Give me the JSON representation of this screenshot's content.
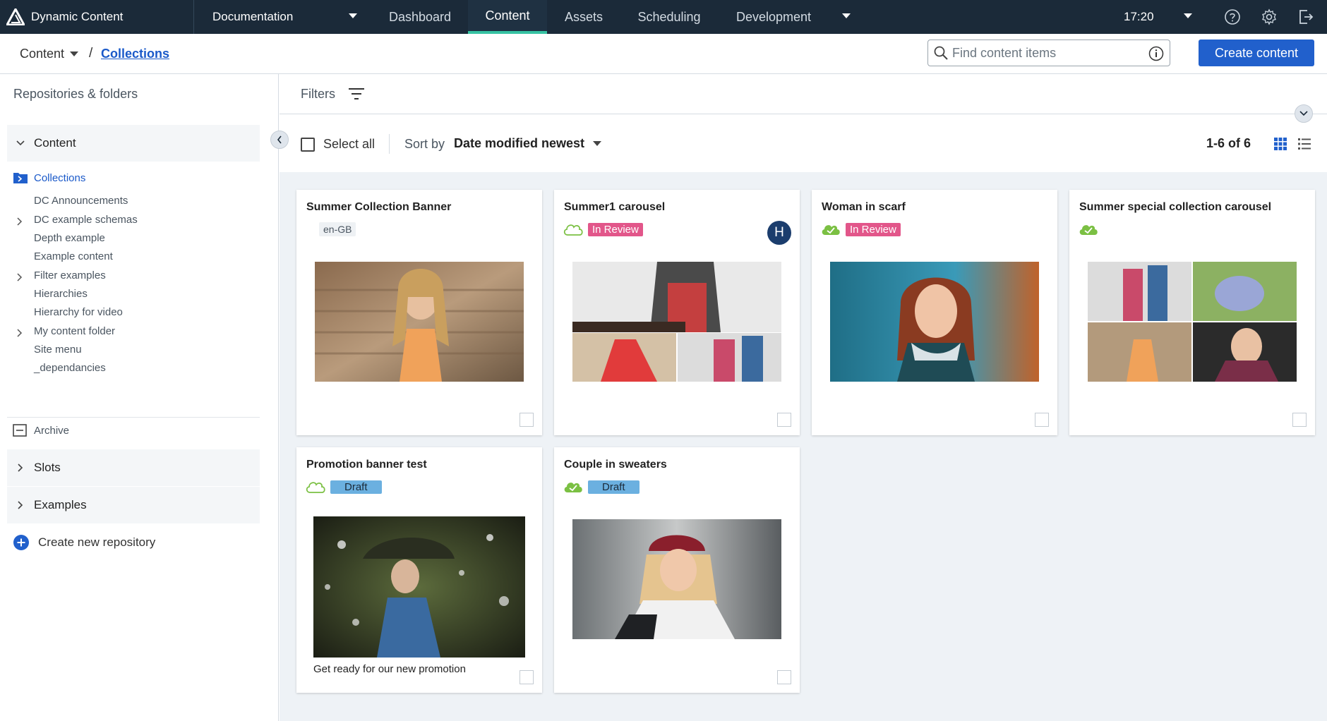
{
  "app": {
    "name": "Dynamic Content",
    "hub": "Documentation"
  },
  "nav": {
    "tabs": [
      {
        "label": "Dashboard"
      },
      {
        "label": "Content"
      },
      {
        "label": "Assets"
      },
      {
        "label": "Scheduling"
      },
      {
        "label": "Development"
      }
    ],
    "active_tab": "Content",
    "time": "17:20"
  },
  "breadcrumb": {
    "root": "Content",
    "separator": "/",
    "current": "Collections"
  },
  "search": {
    "placeholder": "Find content items"
  },
  "create_button": "Create content",
  "sidebar": {
    "title": "Repositories & folders",
    "groups": [
      {
        "label": "Content",
        "expanded": true
      },
      {
        "label": "Slots",
        "expanded": false
      },
      {
        "label": "Examples",
        "expanded": false
      }
    ],
    "items": [
      {
        "label": "Collections",
        "selected": true
      },
      {
        "label": "DC Announcements"
      },
      {
        "label": "DC example schemas",
        "expandable": true
      },
      {
        "label": "Depth example"
      },
      {
        "label": "Example content"
      },
      {
        "label": "Filter examples",
        "expandable": true
      },
      {
        "label": "Hierarchies"
      },
      {
        "label": "Hierarchy for video"
      },
      {
        "label": "My content folder",
        "expandable": true
      },
      {
        "label": "Site menu"
      },
      {
        "label": "_dependancies"
      }
    ],
    "archive": "Archive",
    "create_repo": "Create new repository"
  },
  "filters": {
    "label": "Filters"
  },
  "toolbar": {
    "select_all": "Select all",
    "sort_by_label": "Sort by",
    "sort_value": "Date modified newest",
    "count": "1-6 of 6",
    "view": "grid"
  },
  "cards": [
    {
      "title": "Summer Collection Banner",
      "locale": "en-GB",
      "sync": "none",
      "status": ""
    },
    {
      "title": "Summer1 carousel",
      "sync": "outline",
      "status": "In Review",
      "assignee": "H"
    },
    {
      "title": "Woman in scarf",
      "sync": "published",
      "status": "In Review"
    },
    {
      "title": "Summer special collection carousel",
      "sync": "published",
      "status": ""
    },
    {
      "title": "Promotion banner test",
      "sync": "outline",
      "status": "Draft",
      "caption": "Get ready for our new promotion"
    },
    {
      "title": "Couple in sweaters",
      "sync": "published",
      "status": "Draft"
    }
  ],
  "colors": {
    "topbar": "#1b2a39",
    "accent_tab": "#37c3a3",
    "primary": "#2160cc",
    "link": "#1a59c9",
    "in_review": "#e2568a",
    "draft": "#6bb0e0",
    "published": "#7bc043"
  },
  "icons": [
    "logo-icon",
    "chevron-down-icon",
    "help-icon",
    "gear-icon",
    "logout-icon",
    "search-icon",
    "info-icon",
    "filter-icon",
    "grid-view-icon",
    "list-view-icon",
    "cloud-icon",
    "cloud-check-icon",
    "folder-icon",
    "archive-icon",
    "plus-icon"
  ]
}
